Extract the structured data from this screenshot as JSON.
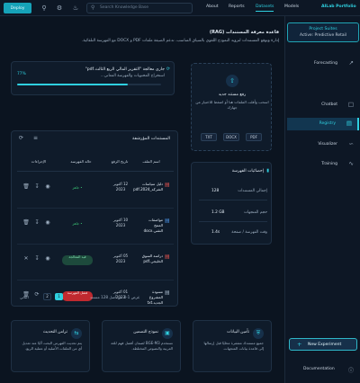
{
  "topbar": {
    "deploy_label": "Deploy",
    "search_placeholder": "Search Knowledge Base",
    "nav": [
      "About",
      "Reports",
      "Datasets",
      "Models"
    ],
    "active_nav": "Datasets",
    "brand": "AILab Portfolio"
  },
  "sidebar": {
    "project_title": "Project Suites",
    "project_active": "Active: Predictive Retail",
    "items": [
      {
        "label": "Forecasting",
        "icon": "trend-icon"
      },
      {
        "label": "Chatbot",
        "icon": "chat-icon"
      },
      {
        "label": "Registry",
        "icon": "database-icon",
        "active": true
      },
      {
        "label": "Visualizer",
        "icon": "chart-icon"
      },
      {
        "label": "Training",
        "icon": "pulse-icon"
      }
    ],
    "new_experiment": "New Experiment",
    "documentation": "Documentation"
  },
  "main": {
    "title": "قاعدة معرفة المستندات (RAG)",
    "subtitle": "إدارة وتوقع المستندات لتزويد النموذج اللغوي بالسياق المناسب. تدعم الصيغة ملفات PDF و DOCX مع الفهرسة التلقائية."
  },
  "processing": {
    "title": "جاري معالجة \"التقرير المالي الربع الثالث.pdf\"",
    "subtitle": "استخراج المحتويات والفهرسة المعاني...",
    "percent_label": "77%",
    "progress": 0.77
  },
  "upload": {
    "title": "رفع مستند جديد",
    "subtitle": "اسحب وأفلت الملفات هنا أو اضغط للاختيار من جهازك",
    "formats": [
      "TXT",
      "DOCX",
      "PDF"
    ]
  },
  "stats": {
    "title": "إحصائيات الفهرسة",
    "rows": [
      {
        "label": "إجمالي المستندات",
        "value": "128"
      },
      {
        "label": "حجم المتجهات",
        "value": "1.2 GB"
      },
      {
        "label": "وقت الفهرسة / صفحة",
        "value": "1.4s"
      }
    ]
  },
  "documents": {
    "title": "المستندات المؤرشفة",
    "headers": [
      "اسم الملف",
      "تاريخ الرفع",
      "حالة الفهرسة",
      "الإجراءات"
    ],
    "rows": [
      {
        "name": "دليل سياسات الشركة_2024.pdf",
        "date": "12 أكتوبر 2023",
        "status": "• جاهز",
        "status_kind": "ok",
        "file_icon": "pdf-file-icon",
        "file_color": "#e0524f"
      },
      {
        "name": "مواصفات المنتج التقني.docx",
        "date": "10 أكتوبر 2023",
        "status": "• جاهز",
        "status_kind": "ok",
        "file_icon": "doc-file-icon",
        "file_color": "#4a90e2"
      },
      {
        "name": "دراسة السوق الخليجي.pdf",
        "date": "05 أكتوبر 2023",
        "status": "قيد المعالجة",
        "status_kind": "processing",
        "file_icon": "pdf-file-icon",
        "file_color": "#e0524f"
      },
      {
        "name": "مسودة المشروع الجديد.txt",
        "date": "01 أكتوبر 2023",
        "status": "فشل الفهرسة",
        "status_kind": "failed",
        "file_icon": "txt-file-icon",
        "file_color": "#9fb0c2"
      }
    ],
    "pagination": {
      "info": "عرض 1-4 من أصل 128 مستند",
      "pages": [
        "1",
        "2"
      ],
      "active_page": "1",
      "next": "التالي"
    }
  },
  "features": [
    {
      "title": "تأمين البيانات",
      "desc": "جميع مستندك مشفرة محليًا قبل إرسالها إلى قاعدة بيانات المتجهات.",
      "icon": "shield-icon"
    },
    {
      "title": "نموذج التضمين",
      "desc": "نستخدم BGE-M3 لضمان أفضل فهم للغة العربية والنصوص المختلطة.",
      "icon": "cube-icon"
    },
    {
      "title": "تزامن التحديث",
      "desc": "يتم تحديث الفهرس البحث آليًا عند تعديل أي من الملفات الأصلية أو عملية الربع.",
      "icon": "sync-icon"
    }
  ]
}
